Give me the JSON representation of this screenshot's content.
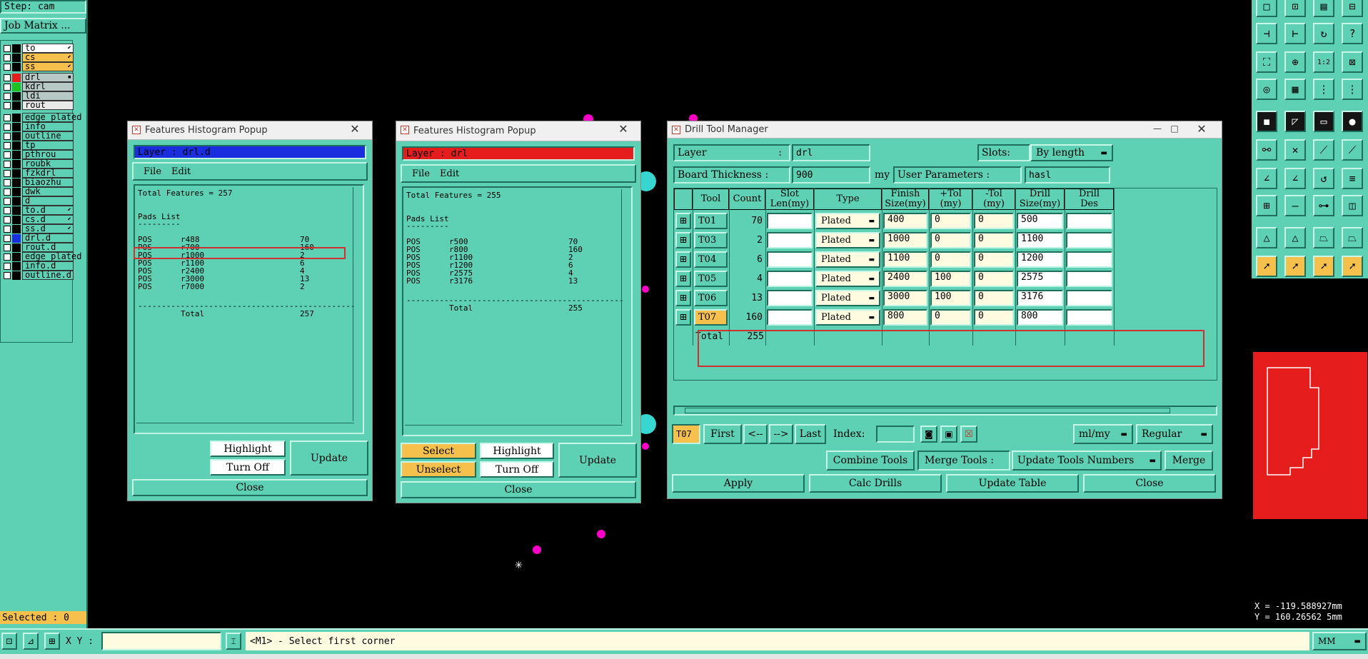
{
  "step_label": "Step: cam",
  "job_matrix": "Job Matrix ...",
  "layers": [
    {
      "name": "to",
      "color": "#ffffff",
      "swatch": "#000000",
      "mark": "⬋"
    },
    {
      "name": "cs",
      "color": "#f5c04c",
      "swatch": "#000000",
      "mark": "⬋"
    },
    {
      "name": "ss",
      "color": "#f5c04c",
      "swatch": "#000000",
      "mark": "⬋"
    },
    {
      "name": "drl",
      "color": "#b8c8c4",
      "swatch": "#e51d1d",
      "mark": "▪"
    },
    {
      "name": "kdrl",
      "color": "#b8c8c4",
      "swatch": "#20c020",
      "mark": ""
    },
    {
      "name": "ldi",
      "color": "#b8c8c4",
      "swatch": "#000000",
      "mark": ""
    },
    {
      "name": "rout",
      "color": "#e9e9e9",
      "swatch": "#000000",
      "mark": ""
    },
    {
      "name": "edge_plated",
      "color": "#5ed1b4",
      "swatch": "#000000",
      "mark": ""
    },
    {
      "name": "info",
      "color": "#5ed1b4",
      "swatch": "#000000",
      "mark": ""
    },
    {
      "name": "outline",
      "color": "#5ed1b4",
      "swatch": "#000000",
      "mark": ""
    },
    {
      "name": "tp",
      "color": "#5ed1b4",
      "swatch": "#000000",
      "mark": ""
    },
    {
      "name": "pthrou",
      "color": "#5ed1b4",
      "swatch": "#000000",
      "mark": ""
    },
    {
      "name": "roubk",
      "color": "#5ed1b4",
      "swatch": "#000000",
      "mark": ""
    },
    {
      "name": "fzkdrl",
      "color": "#5ed1b4",
      "swatch": "#000000",
      "mark": ""
    },
    {
      "name": "biaozhu",
      "color": "#5ed1b4",
      "swatch": "#000000",
      "mark": ""
    },
    {
      "name": "dwk",
      "color": "#5ed1b4",
      "swatch": "#000000",
      "mark": ""
    },
    {
      "name": "d",
      "color": "#5ed1b4",
      "swatch": "#000000",
      "mark": ""
    },
    {
      "name": "to.d",
      "color": "#5ed1b4",
      "swatch": "#000000",
      "mark": "⬋"
    },
    {
      "name": "cs.d",
      "color": "#5ed1b4",
      "swatch": "#000000",
      "mark": "⬋"
    },
    {
      "name": "ss.d",
      "color": "#5ed1b4",
      "swatch": "#000000",
      "mark": "⬋"
    },
    {
      "name": "drl.d",
      "color": "#5ed1b4",
      "swatch": "#1a2ee0",
      "mark": ""
    },
    {
      "name": "rout.d",
      "color": "#5ed1b4",
      "swatch": "#000000",
      "mark": ""
    },
    {
      "name": "edge_plated",
      "color": "#5ed1b4",
      "swatch": "#000000",
      "mark": ""
    },
    {
      "name": "info.d",
      "color": "#5ed1b4",
      "swatch": "#000000",
      "mark": ""
    },
    {
      "name": "outline.d",
      "color": "#5ed1b4",
      "swatch": "#000000",
      "mark": ""
    }
  ],
  "selected_label": "Selected : 0",
  "hist1": {
    "title": "Features Histogram Popup",
    "layer_label": "Layer :  drl.d",
    "layer_color": "#1a2ee0",
    "menu": [
      "File",
      "Edit"
    ],
    "total": "Total Features = 257",
    "list_title": "Pads List",
    "underline": "---------",
    "rows": [
      [
        "POS",
        "r488",
        "70"
      ],
      [
        "POS",
        "r700",
        "160"
      ],
      [
        "POS",
        "r1000",
        "2"
      ],
      [
        "POS",
        "r1100",
        "6"
      ],
      [
        "POS",
        "r2400",
        "4"
      ],
      [
        "POS",
        "r3000",
        "13"
      ],
      [
        "POS",
        "r7000",
        "2"
      ]
    ],
    "divider": "----------------------------------------------",
    "total_row": [
      "Total",
      "257"
    ],
    "highlight": "Highlight",
    "turn_off": "Turn Off",
    "update": "Update",
    "close": "Close"
  },
  "hist2": {
    "title": "Features Histogram Popup",
    "layer_label": "Layer :  drl",
    "layer_color": "#e51d1d",
    "menu": [
      "File",
      "Edit"
    ],
    "total": "Total Features = 255",
    "list_title": "Pads List",
    "underline": "---------",
    "rows": [
      [
        "POS",
        "r500",
        "70"
      ],
      [
        "POS",
        "r800",
        "160"
      ],
      [
        "POS",
        "r1100",
        "2"
      ],
      [
        "POS",
        "r1200",
        "6"
      ],
      [
        "POS",
        "r2575",
        "4"
      ],
      [
        "POS",
        "r3176",
        "13"
      ]
    ],
    "divider": "----------------------------------------------",
    "total_row": [
      "Total",
      "255"
    ],
    "select": "Select",
    "unselect": "Unselect",
    "highlight": "Highlight",
    "turn_off": "Turn Off",
    "update": "Update",
    "close": "Close"
  },
  "dtm": {
    "title": "Drill Tool Manager",
    "layer_label": "Layer",
    "layer_colon": ":",
    "layer_value": "drl",
    "slots_label": "Slots:",
    "slots_value": "By length",
    "board_thickness_label": "Board Thickness :",
    "board_thickness_value": "900",
    "board_unit": "my",
    "user_params_label": "User Parameters :",
    "user_params_value": "hasl",
    "columns": [
      "Tool",
      "Count",
      "Slot\nLen(my)",
      "Type",
      "Finish\nSize(my)",
      "+Tol\n(my)",
      "-Tol\n(my)",
      "Drill\nSize(my)",
      "Drill\nDes"
    ],
    "rows": [
      {
        "tool": "T01",
        "count": "70",
        "slot": "",
        "type": "Plated",
        "finish": "400",
        "ptol": "0",
        "mtol": "0",
        "drill": "500",
        "des": ""
      },
      {
        "tool": "T03",
        "count": "2",
        "slot": "",
        "type": "Plated",
        "finish": "1000",
        "ptol": "0",
        "mtol": "0",
        "drill": "1100",
        "des": ""
      },
      {
        "tool": "T04",
        "count": "6",
        "slot": "",
        "type": "Plated",
        "finish": "1100",
        "ptol": "0",
        "mtol": "0",
        "drill": "1200",
        "des": ""
      },
      {
        "tool": "T05",
        "count": "4",
        "slot": "",
        "type": "Plated",
        "finish": "2400",
        "ptol": "100",
        "mtol": "0",
        "drill": "2575",
        "des": ""
      },
      {
        "tool": "T06",
        "count": "13",
        "slot": "",
        "type": "Plated",
        "finish": "3000",
        "ptol": "100",
        "mtol": "0",
        "drill": "3176",
        "des": ""
      },
      {
        "tool": "T07",
        "count": "160",
        "slot": "",
        "type": "Plated",
        "finish": "800",
        "ptol": "0",
        "mtol": "0",
        "drill": "800",
        "des": ""
      }
    ],
    "total_label": "Total",
    "total_value": "255",
    "current_tool": "T07",
    "nav": [
      "First",
      "<--",
      "-->",
      "Last"
    ],
    "index_label": "Index:",
    "unit_select": "ml/my",
    "mode_select": "Regular",
    "combine_tools": "Combine Tools",
    "merge_tools_label": "Merge Tools :",
    "merge_tools_select": "Update Tools Numbers",
    "merge": "Merge",
    "apply": "Apply",
    "calc_drills": "Calc Drills",
    "update_table": "Update Table",
    "close": "Close"
  },
  "coords": {
    "x": "X = -119.588927mm",
    "y": "Y = 160.26562 5mm"
  },
  "statusbar": {
    "xy_label": "X Y :",
    "prompt": "<M1> - Select first corner",
    "units": "MM"
  },
  "tool_icons": [
    "square-icon",
    "select-icon",
    "layers-icon",
    "grid-icon",
    "fit-icon",
    "pan-icon",
    "redo-icon",
    "help-icon",
    "zoom-fit-icon",
    "zoom-in-icon",
    "scale-icon",
    "window-icon",
    "measure-icon",
    "grid-toggle-icon",
    "snap-icon",
    "snap2-icon",
    "fill-icon",
    "rotate-icon",
    "ruler-icon",
    "dot-icon",
    "net-icon",
    "cross-icon",
    "line-icon",
    "line2-icon",
    "arc-icon",
    "arc2-icon",
    "curve-icon",
    "filter-icon",
    "route-icon",
    "move-icon",
    "dim-icon",
    "group-icon",
    "triangle-icon",
    "triangle2-icon",
    "trapezoid-icon",
    "trapezoid2-icon",
    "pointer-icon",
    "pointer2-icon",
    "pointer3-icon",
    "pointer4-icon"
  ]
}
